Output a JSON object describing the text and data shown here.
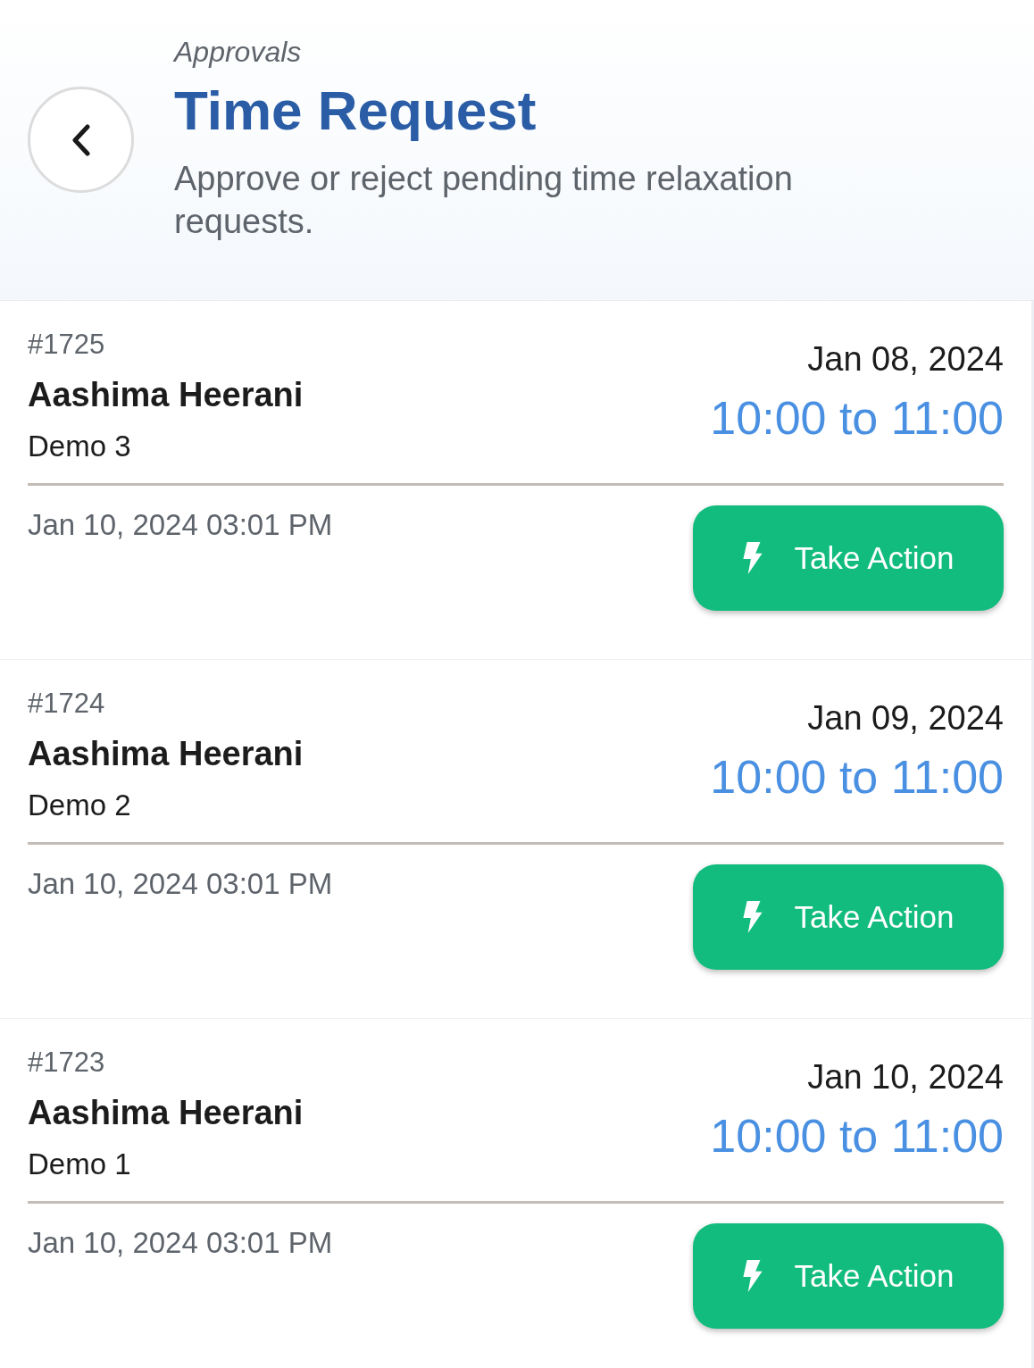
{
  "header": {
    "breadcrumb": "Approvals",
    "title": "Time Request",
    "subtitle": "Approve or reject pending time relaxation requests."
  },
  "requests": [
    {
      "id": "#1725",
      "name": "Aashima Heerani",
      "label": "Demo 3",
      "date": "Jan 08, 2024",
      "time_range": "10:00 to 11:00",
      "submitted": "Jan 10, 2024 03:01 PM",
      "action": "Take Action"
    },
    {
      "id": "#1724",
      "name": "Aashima Heerani",
      "label": "Demo 2",
      "date": "Jan 09, 2024",
      "time_range": "10:00 to 11:00",
      "submitted": "Jan 10, 2024 03:01 PM",
      "action": "Take Action"
    },
    {
      "id": "#1723",
      "name": "Aashima Heerani",
      "label": "Demo 1",
      "date": "Jan 10, 2024",
      "time_range": "10:00 to 11:00",
      "submitted": "Jan 10, 2024 03:01 PM",
      "action": "Take Action"
    }
  ]
}
